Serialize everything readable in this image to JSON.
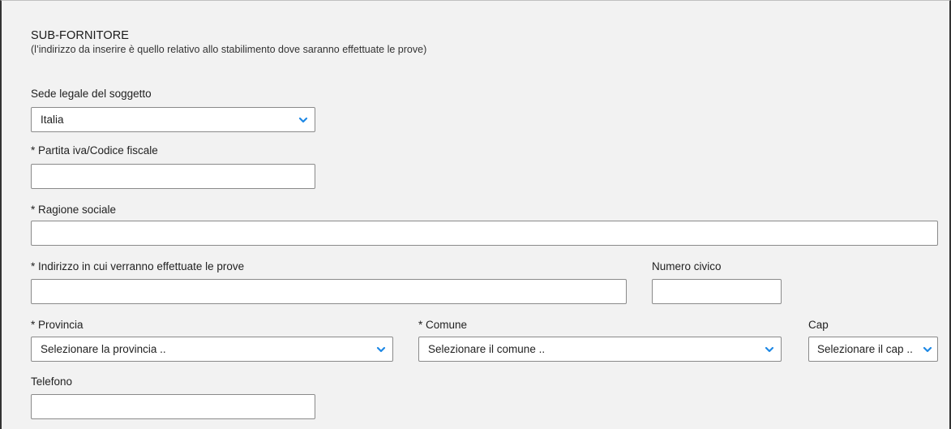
{
  "section": {
    "title": "SUB-FORNITORE",
    "subtitle": "(l’indirizzo da inserire è quello relativo allo stabilimento dove saranno effettuate le prove)"
  },
  "fields": {
    "sede_legale": {
      "label": "Sede legale del soggetto",
      "value": "Italia"
    },
    "partita_iva": {
      "label": "* Partita iva/Codice fiscale",
      "value": "",
      "placeholder": ""
    },
    "ragione_sociale": {
      "label": "* Ragione sociale",
      "value": "",
      "placeholder": ""
    },
    "indirizzo": {
      "label": "* Indirizzo in cui verranno effettuate le prove",
      "value": "",
      "placeholder": ""
    },
    "numero_civico": {
      "label": "Numero civico",
      "value": "",
      "placeholder": ""
    },
    "provincia": {
      "label": "* Provincia",
      "value": "Selezionare la provincia .."
    },
    "comune": {
      "label": "* Comune",
      "value": "Selezionare il comune .."
    },
    "cap": {
      "label": "Cap",
      "value": "Selezionare il cap .."
    },
    "telefono": {
      "label": "Telefono",
      "value": "",
      "placeholder": ""
    }
  },
  "colors": {
    "panel_bg": "#f2f2f2",
    "chevron": "#1e88e5",
    "field_border": "#8a8a8a"
  },
  "icons": {
    "dropdown": "chevron-down-icon"
  }
}
